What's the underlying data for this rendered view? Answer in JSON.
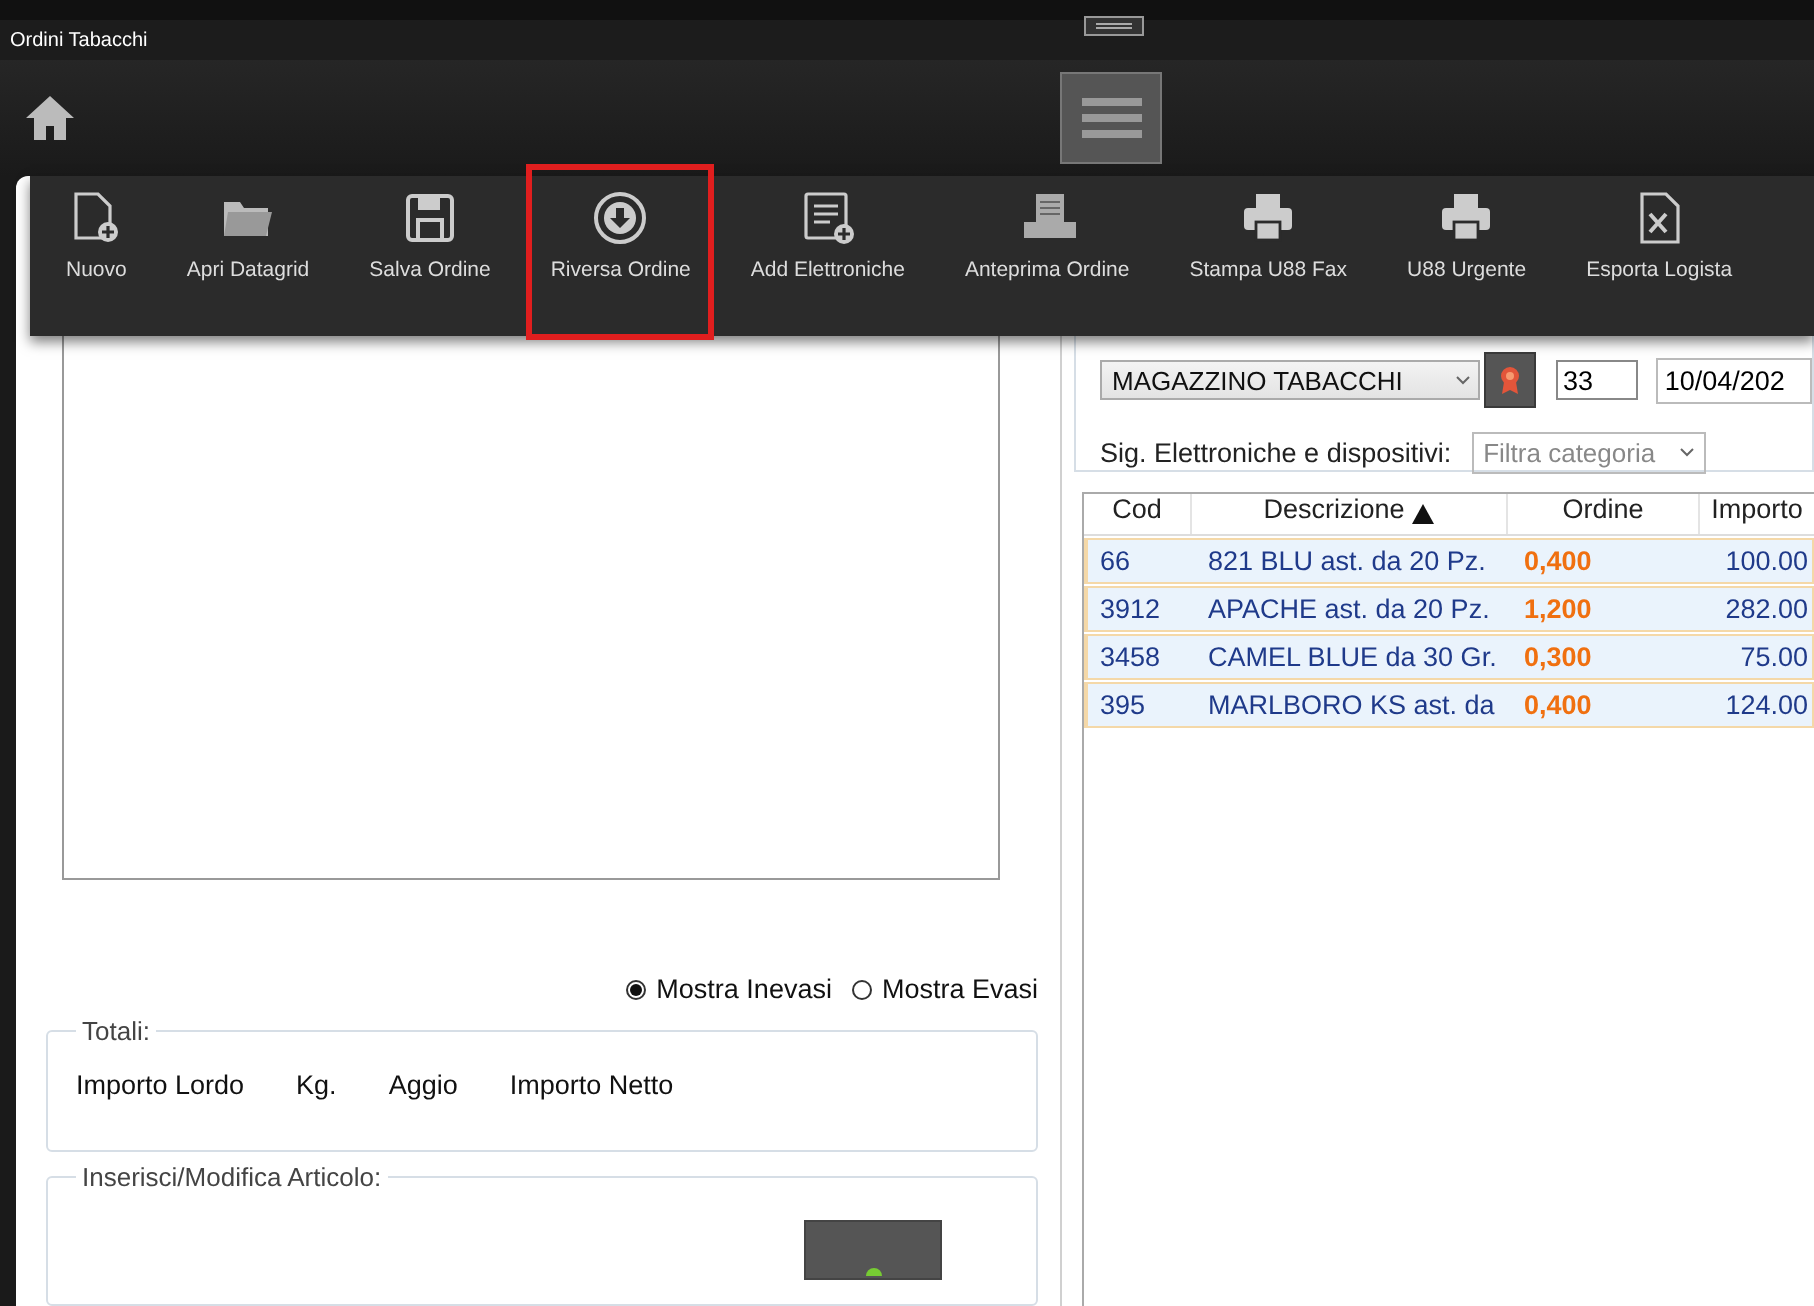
{
  "window": {
    "title": "Ordini Tabacchi"
  },
  "toolbar": {
    "items": [
      {
        "label": "Nuovo",
        "kind": "new",
        "highlighted": false
      },
      {
        "label": "Apri Datagrid",
        "kind": "folder",
        "highlighted": false
      },
      {
        "label": "Salva Ordine",
        "kind": "save",
        "highlighted": false
      },
      {
        "label": "Riversa Ordine",
        "kind": "download",
        "highlighted": true
      },
      {
        "label": "Add Elettroniche",
        "kind": "addlist",
        "highlighted": false
      },
      {
        "label": "Anteprima Ordine",
        "kind": "preview",
        "highlighted": false
      },
      {
        "label": "Stampa U88 Fax",
        "kind": "print",
        "highlighted": false
      },
      {
        "label": "U88 Urgente",
        "kind": "print",
        "highlighted": false
      },
      {
        "label": "Esporta Logista",
        "kind": "excel",
        "highlighted": false
      }
    ]
  },
  "document": {
    "supplier": {
      "value": "MAGAZZINO TABACCHI"
    },
    "number": {
      "value": "33"
    },
    "date": {
      "value": "10/04/202"
    },
    "category_filter": {
      "label": "Sig. Elettroniche e dispositivi:",
      "placeholder": "Filtra categoria"
    }
  },
  "table": {
    "columns": [
      {
        "label": "Cod",
        "sorted": false
      },
      {
        "label": "Descrizione",
        "sorted": true
      },
      {
        "label": "Ordine",
        "sorted": false
      },
      {
        "label": "Importo",
        "sorted": false
      }
    ],
    "rows": [
      {
        "cod": "66",
        "descrizione": "821 BLU ast. da 20 Pz.",
        "ordine": "0,400",
        "importo": "100.00"
      },
      {
        "cod": "3912",
        "descrizione": "APACHE ast. da 20 Pz.",
        "ordine": "1,200",
        "importo": "282.00"
      },
      {
        "cod": "3458",
        "descrizione": "CAMEL BLUE da 30 Gr.",
        "ordine": "0,300",
        "importo": "75.00"
      },
      {
        "cod": "395",
        "descrizione": "MARLBORO KS ast. da",
        "ordine": "0,400",
        "importo": "124.00"
      }
    ]
  },
  "filter": [
    {
      "label": "Mostra Inevasi",
      "selected": true
    },
    {
      "label": "Mostra Evasi",
      "selected": false
    }
  ],
  "totals": {
    "title": "Totali:",
    "labels": [
      "Importo Lordo",
      "Kg.",
      "Aggio",
      "Importo Netto"
    ]
  },
  "edit_section": {
    "title": "Inserisci/Modifica Articolo:"
  }
}
